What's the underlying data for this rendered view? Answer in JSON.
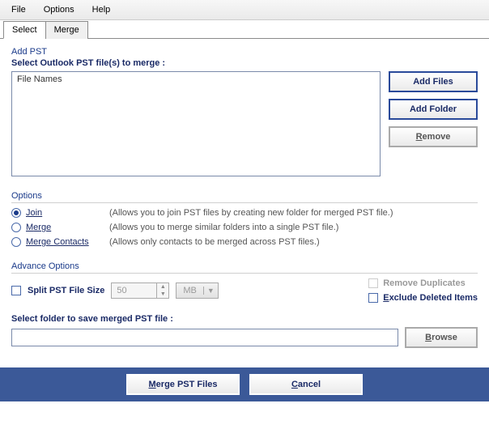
{
  "menu": {
    "file": "File",
    "options": "Options",
    "help": "Help"
  },
  "tabs": {
    "select": "Select",
    "merge": "Merge"
  },
  "addpst": {
    "title": "Add PST",
    "subtitle": "Select Outlook PST file(s) to merge :",
    "column_header": "File Names",
    "add_files": "Add Files",
    "add_folder": "Add Folder",
    "remove_pre": "",
    "remove_u": "R",
    "remove_post": "emove"
  },
  "options": {
    "title": "Options",
    "join_u": "J",
    "join_post": "oin",
    "join_desc": "(Allows you to join PST files by creating new folder for merged PST file.)",
    "merge_u": "M",
    "merge_post": "erge",
    "merge_desc": "(Allows you to merge similar folders into a single PST file.)",
    "contacts_pre": "Merge ",
    "contacts_u": "C",
    "contacts_post": "ontacts",
    "contacts_desc": "(Allows only contacts to be merged across PST files.)"
  },
  "advance": {
    "title": "Advance Options",
    "split_label": "Split PST File Size",
    "spin_value": "50",
    "unit": "MB",
    "remove_dup": "Remove Duplicates",
    "excl_pre": "",
    "excl_u": "E",
    "excl_post": "xclude Deleted Items"
  },
  "save": {
    "label": "Select folder to save merged PST file :",
    "browse_u": "B",
    "browse_post": "rowse"
  },
  "footer": {
    "merge_u": "M",
    "merge_post": "erge PST Files",
    "cancel_u": "C",
    "cancel_post": "ancel"
  }
}
